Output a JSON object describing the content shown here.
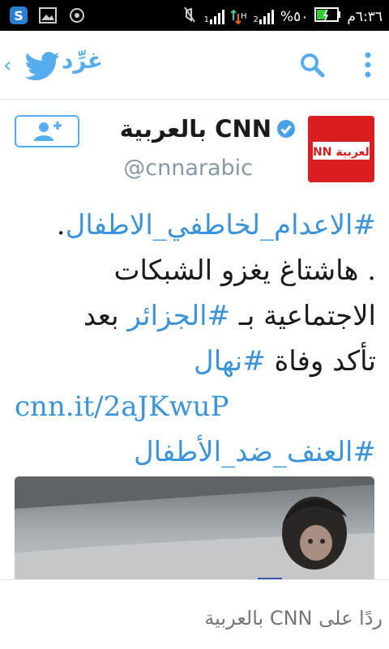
{
  "status_bar": {
    "time": "٦:٣٦م",
    "battery_percent_text": "%٥٠",
    "signal_1_label": "1",
    "signal_2_label": "2",
    "net_label": "H"
  },
  "header": {
    "title": "غرِّد",
    "icons": [
      "chevron-left-icon",
      "twitter-bird-icon",
      "search-icon",
      "overflow-menu-icon"
    ],
    "accent_color": "#55acee"
  },
  "profile": {
    "name": "CNN بالعربية",
    "handle": "@cnnarabic",
    "follow_button_icon": "add-user-icon",
    "avatar_text": "CNN بالعربية"
  },
  "tweet": {
    "line1_hashtag": "#الاعدام_لخاطفي_الاطفال",
    "line1_tail": ".",
    "line2": ". هاشتاغ يغزو الشبكات",
    "line3_a": "الاجتماعية بـ",
    "line3_hashtag": "#الجزائر",
    "line3_b": "بعد",
    "line4_a": "تأكد وفاة",
    "line4_hashtag": "#نهال",
    "link": "cnn.it/2aJKwuP",
    "line6_hashtag": "#العنف_ضد_الأطفال"
  },
  "reply": {
    "placeholder": "ردًا على CNN بالعربية"
  }
}
